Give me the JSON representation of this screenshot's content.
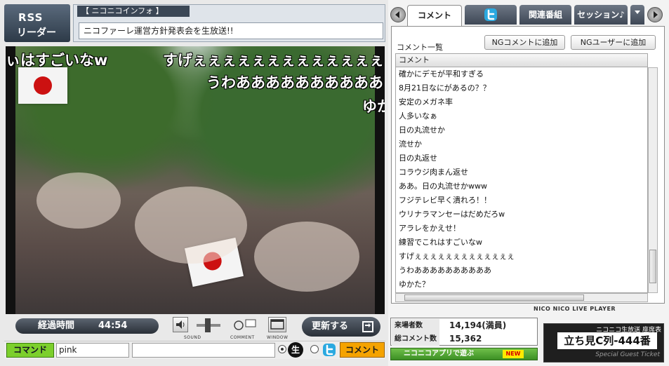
{
  "header": {
    "rss_line1": "RSS",
    "rss_line2": "リーダー",
    "info_title": "【 ニコニコインフォ 】",
    "info_text": "ニコファーレ運営方針発表会を生放送!!"
  },
  "danmaku": [
    "ぃはすごいなw",
    "すげぇぇぇぇぇぇぇぇぇぇぇぇぇ",
    "うわああああああああああ",
    "ゆか"
  ],
  "controls": {
    "elapsed_label": "経過時間",
    "elapsed_value": "44:54",
    "sound_label": "SOUND",
    "comment_label": "COMMENT",
    "window_label": "WINDOW",
    "refresh_label": "更新する"
  },
  "command_bar": {
    "command_label": "コマンド",
    "command_value": "pink",
    "comment_value": "",
    "live_mark": "生",
    "comment_button": "コメント"
  },
  "tabs": [
    "コメント",
    "",
    "関連番組",
    "セッション♪"
  ],
  "comments_panel": {
    "caption": "コメント一覧",
    "ng_comment_button": "NGコメントに追加",
    "ng_user_button": "NGユーザーに追加",
    "column_header": "コメント",
    "rows": [
      "確かにデモが平和すぎる",
      "8月21日なにがあるの？？",
      "安定のメガネ率",
      "人多いなぁ",
      "日の丸流せか",
      "流せか",
      "日の丸返せ",
      "コラウジ肉まん返せ",
      "ああ。日の丸流せかwww",
      "フジテレビ早く潰れろ！！",
      "ウリナラマンセーはだめだろw",
      "アラレをかえせ！",
      "練習でこれはすごいなw",
      "すげぇぇぇぇぇぇぇぇぇぇぇぇぇ",
      "うわああああああああああ",
      "ゆかた？"
    ],
    "brand": "NICO NICO LIVE PLAYER"
  },
  "stats": {
    "visitors_label": "来場者数",
    "visitors_value": "14,194(満員)",
    "comments_label": "総コメント数",
    "comments_value": "15,362"
  },
  "app_button": {
    "label": "ニコニコアプリで遊ぶ",
    "badge": "NEW"
  },
  "ticket": {
    "header": "ニコニコ生放送 座席表",
    "seat": "立ち見C列-444番",
    "footer": "Special Guest Ticket"
  },
  "colors": {
    "command_green": "#7ccf2c",
    "comment_orange": "#f5a300",
    "dark_slate": "#3e4755",
    "twitter_blue": "#2aa9e0",
    "flag_red": "#cc1111"
  }
}
